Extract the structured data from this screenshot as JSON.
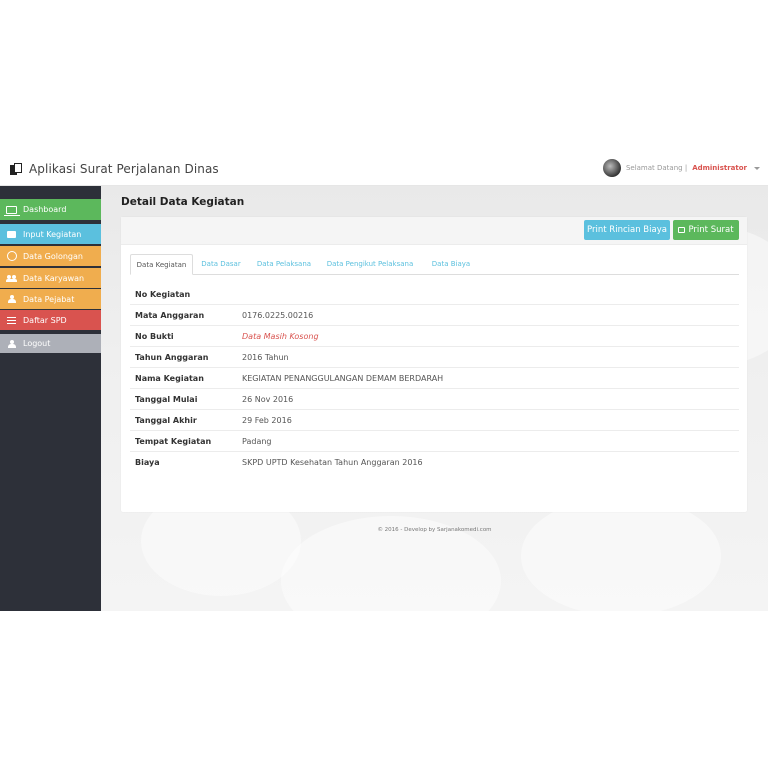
{
  "app": {
    "title": "Aplikasi Surat Perjalanan Dinas"
  },
  "user": {
    "greeting": "Selamat Datang |",
    "name": "Administrator"
  },
  "sidebar": {
    "items": [
      {
        "label": "Dashboard",
        "icon": "laptop-icon",
        "color": "#5cb85c"
      },
      {
        "label": "Input Kegiatan",
        "icon": "book-icon",
        "color": "#5bc0de"
      },
      {
        "label": "Data Golongan",
        "icon": "circle-icon",
        "color": "#f0ad4e"
      },
      {
        "label": "Data Karyawan",
        "icon": "users-icon",
        "color": "#f0ad4e"
      },
      {
        "label": "Data Pejabat",
        "icon": "user-icon",
        "color": "#f0ad4e"
      },
      {
        "label": "Daftar SPD",
        "icon": "list-icon",
        "color": "#d9534f"
      },
      {
        "label": "Logout",
        "icon": "user-icon",
        "color": "#adb0b8"
      }
    ]
  },
  "main": {
    "title": "Detail Data Kegiatan",
    "buttons": {
      "print_rincian": "Print Rincian Biaya",
      "print_surat": "Print Surat"
    },
    "tabs": [
      {
        "label": "Data Kegiatan",
        "active": true
      },
      {
        "label": "Data Dasar",
        "active": false
      },
      {
        "label": "Data Pelaksana",
        "active": false
      },
      {
        "label": "Data Pengikut Pelaksana",
        "active": false
      },
      {
        "label": "Data Biaya",
        "active": false
      }
    ],
    "details": [
      {
        "label": "No Kegiatan",
        "value": ""
      },
      {
        "label": "Mata Anggaran",
        "value": "0176.0225.00216"
      },
      {
        "label": "No Bukti",
        "value": "Data Masih Kosong"
      },
      {
        "label": "Tahun Anggaran",
        "value": "2016 Tahun"
      },
      {
        "label": "Nama Kegiatan",
        "value": "KEGIATAN PENANGGULANGAN DEMAM BERDARAH"
      },
      {
        "label": "Tanggal Mulai",
        "value": "26 Nov 2016"
      },
      {
        "label": "Tanggal Akhir",
        "value": "29 Feb 2016"
      },
      {
        "label": "Tempat Kegiatan",
        "value": "Padang"
      },
      {
        "label": "Biaya",
        "value": "SKPD UPTD Kesehatan Tahun Anggaran 2016"
      }
    ]
  },
  "footer": {
    "text": "© 2016 - Develop by Sarjanakomedi.com"
  },
  "colors": {
    "success": "#5cb85c",
    "info": "#5bc0de",
    "warning": "#f0ad4e",
    "danger": "#d9534f",
    "sidebar_bg": "#2d3039"
  }
}
